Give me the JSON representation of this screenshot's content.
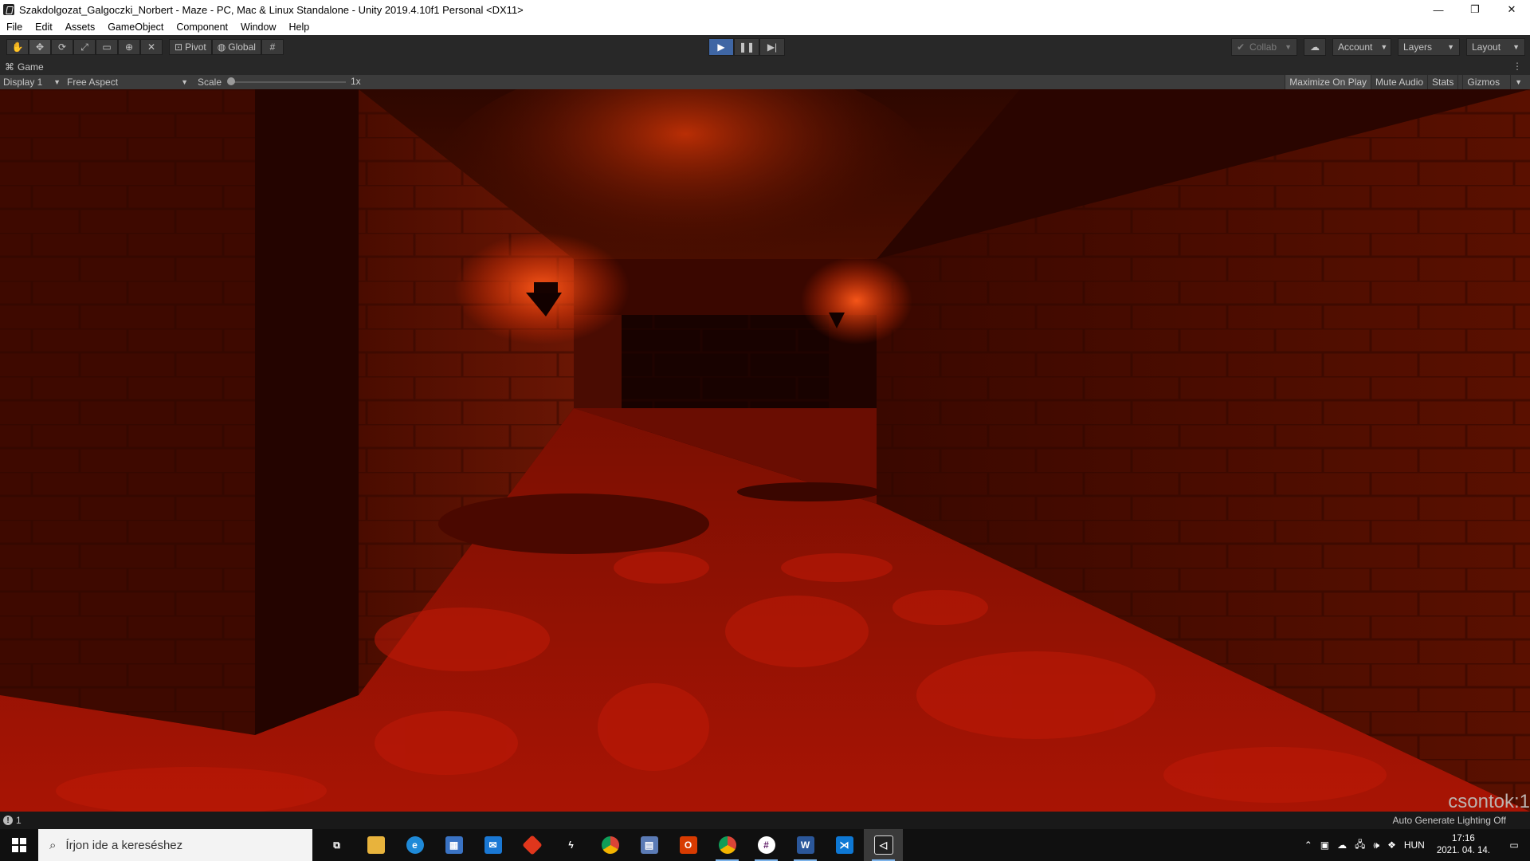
{
  "window": {
    "title": "Szakdolgozat_Galgoczki_Norbert - Maze - PC, Mac & Linux Standalone - Unity 2019.4.10f1 Personal <DX11>",
    "controls": [
      "—",
      "❐",
      "✕"
    ]
  },
  "menu": [
    "File",
    "Edit",
    "Assets",
    "GameObject",
    "Component",
    "Window",
    "Help"
  ],
  "toolbar": {
    "pivot_label": "Pivot",
    "global_label": "Global",
    "collab_label": "Collab",
    "account_label": "Account",
    "layers_label": "Layers",
    "layout_label": "Layout"
  },
  "game_panel": {
    "tab_label": "Game",
    "display_label": "Display 1",
    "aspect_label": "Free Aspect",
    "scale_label": "Scale",
    "scale_value": "1x",
    "maximize_label": "Maximize On Play",
    "mute_label": "Mute Audio",
    "stats_label": "Stats",
    "gizmos_label": "Gizmos",
    "overlay_text": "csontok:1"
  },
  "status": {
    "count": "1",
    "lighting": "Auto Generate Lighting Off"
  },
  "taskbar": {
    "search_placeholder": "Írjon ide a kereséshez",
    "language": "HUN",
    "time": "17:16",
    "date": "2021. 04. 14."
  },
  "colors": {
    "accent_play": "#3f66a4",
    "scene_base": "#2a0500",
    "scene_glow": "#e23a0a"
  }
}
